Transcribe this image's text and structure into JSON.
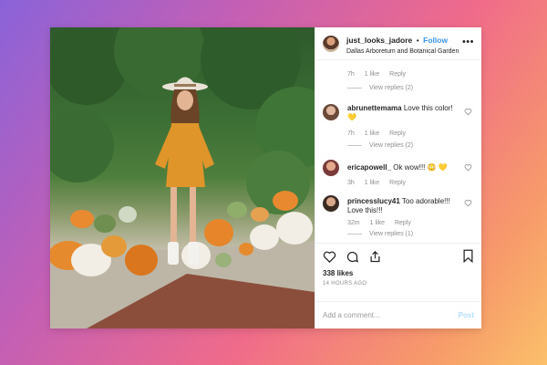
{
  "header": {
    "username": "just_looks_jadore",
    "separator": "•",
    "follow_label": "Follow",
    "location": "Dallas Arboretum and Botanical Garden",
    "more_icon": "more-horizontal-icon"
  },
  "comments": [
    {
      "username": "",
      "text": "",
      "time": "7h",
      "likes": "1 like",
      "reply": "Reply",
      "view_replies": "View replies (2)"
    },
    {
      "username": "abrunettemama",
      "text": "Love this color! 💛",
      "time": "7h",
      "likes": "1 like",
      "reply": "Reply",
      "view_replies": "View replies (2)"
    },
    {
      "username": "ericapowell_",
      "text": "Ok wow!!! 😳 💛",
      "time": "3h",
      "likes": "1 like",
      "reply": "Reply",
      "view_replies": ""
    },
    {
      "username": "princesslucy41",
      "text": "Too adorable!!! Love this!!!",
      "time": "32m",
      "likes": "1 like",
      "reply": "Reply",
      "view_replies": "View replies (1)"
    }
  ],
  "actions": {
    "icons": [
      "heart-icon",
      "comment-icon",
      "share-icon",
      "bookmark-icon"
    ],
    "likes": "338 likes",
    "timestamp": "14 HOURS AGO"
  },
  "add_comment": {
    "placeholder": "Add a comment...",
    "post_label": "Post"
  },
  "colors": {
    "link_blue": "#3897f0",
    "post_disabled": "#b2dffc",
    "muted": "#8e8e8e"
  }
}
